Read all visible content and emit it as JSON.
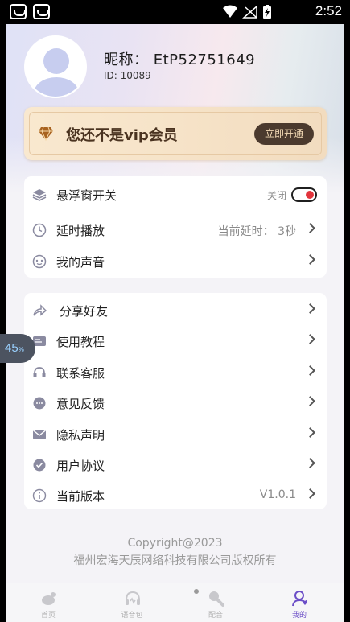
{
  "status_bar": {
    "time": "2:52",
    "icons": [
      "app-notification-icon",
      "app-notification-icon",
      "wifi-icon",
      "no-signal-icon",
      "battery-charging-icon"
    ]
  },
  "profile": {
    "nickname": "昵称：  EtP52751649",
    "user_id": "ID:  10089"
  },
  "vip": {
    "text": "您还不是vip会员",
    "button_label": "立即开通"
  },
  "settings": {
    "floating_window": {
      "label": "悬浮窗开关",
      "toggle_label": "关闭",
      "enabled": false
    },
    "delay_play": {
      "label": "延时播放",
      "value": "当前延时：  3秒"
    },
    "my_voice": {
      "label": "我的声音"
    }
  },
  "menu": {
    "items": [
      {
        "label": "分享好友",
        "icon": "share-icon"
      },
      {
        "label": "使用教程",
        "icon": "tutorial-icon"
      },
      {
        "label": "联系客服",
        "icon": "customer-service-icon"
      },
      {
        "label": "意见反馈",
        "icon": "feedback-icon"
      },
      {
        "label": "隐私声明",
        "icon": "privacy-icon"
      },
      {
        "label": "用户协议",
        "icon": "agreement-icon"
      },
      {
        "label": "当前版本",
        "icon": "info-icon",
        "value": "V1.0.1"
      }
    ]
  },
  "floating_badge": {
    "value": "45",
    "unit": "%"
  },
  "copyright": {
    "line1": "Copyright@2023",
    "line2": "福州宏海天辰网络科技有限公司版权所有"
  },
  "tabbar": {
    "tabs": [
      {
        "label": "首页",
        "icon": "home-icon",
        "active": false
      },
      {
        "label": "语音包",
        "icon": "voice-pack-icon",
        "active": false
      },
      {
        "label": "配音",
        "icon": "dubbing-icon",
        "active": false
      },
      {
        "label": "我的",
        "icon": "profile-icon",
        "active": true
      }
    ]
  },
  "colors": {
    "accent": "#6b4ec7",
    "vip_button": "#4b3a2e",
    "toggle_knob": "#e2343c"
  }
}
